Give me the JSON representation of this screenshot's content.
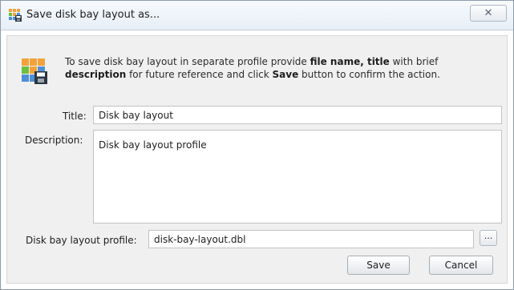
{
  "window": {
    "title": "Save disk bay layout as...",
    "close_glyph": "✕"
  },
  "info": {
    "text_1": "To save disk bay layout in separate profile provide ",
    "bold_1": "file name, title",
    "text_2": " with brief ",
    "bold_2": "description",
    "text_3": " for future reference and click ",
    "bold_3": "Save",
    "text_4": " button to confirm the action."
  },
  "form": {
    "title_label": "Title:",
    "title_value": "Disk bay layout",
    "description_label": "Description:",
    "description_value": "Disk bay layout profile",
    "profile_label": "Disk bay layout profile:",
    "profile_value": "disk-bay-layout.dbl",
    "browse_label": "..."
  },
  "buttons": {
    "save_label": "Save",
    "cancel_label": "Cancel"
  },
  "icons": {
    "title_icon": "disk-bay-save-icon",
    "info_icon": "disk-bay-save-icon"
  },
  "colors": {
    "accent": "#2f6fb3",
    "grid_orange": "#f2a23a",
    "grid_green": "#6cbf3f",
    "grid_blue": "#4f8fd6"
  }
}
